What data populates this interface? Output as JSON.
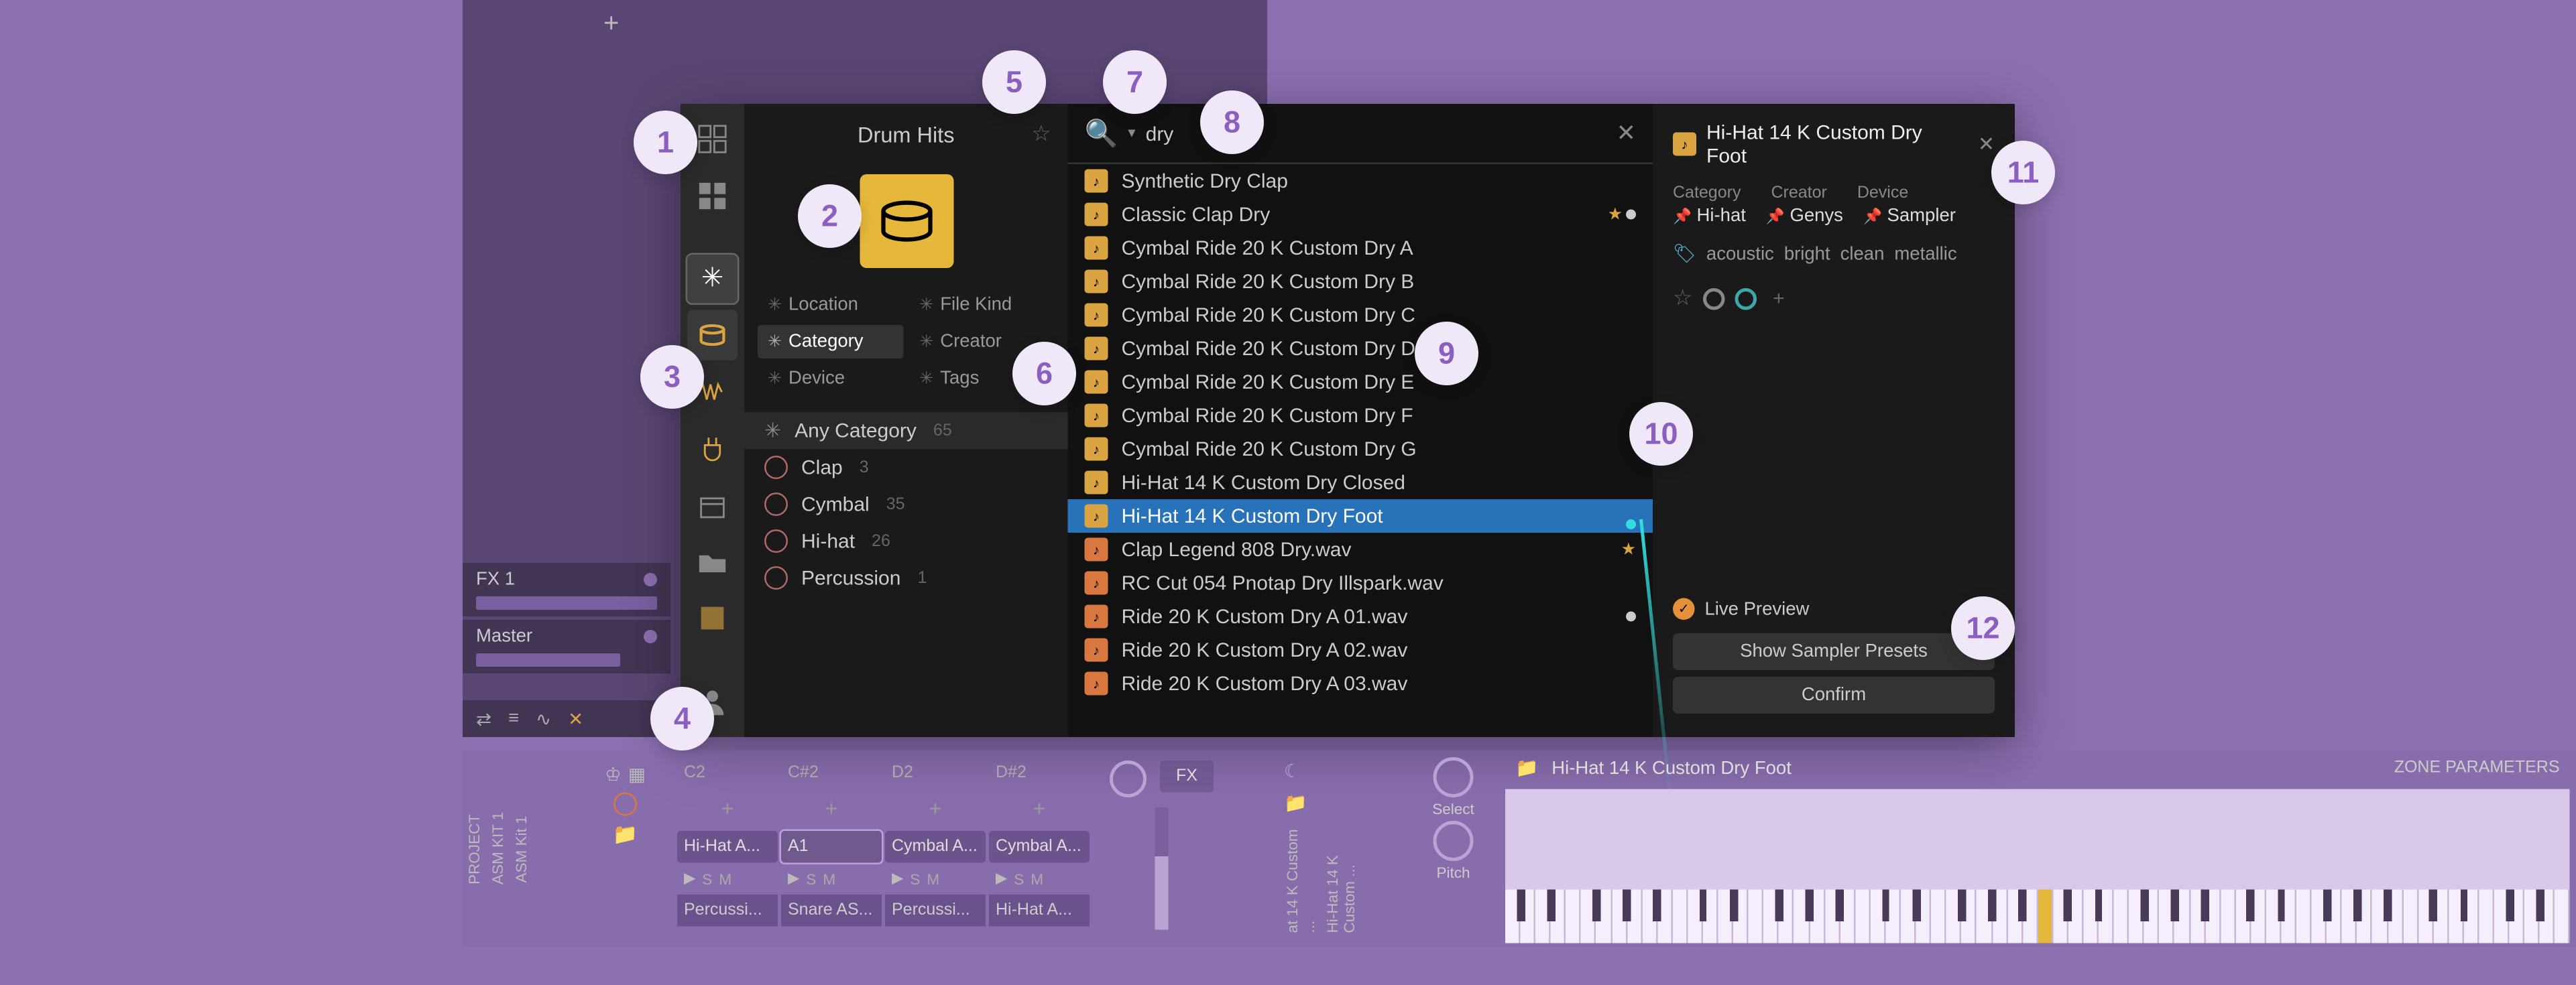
{
  "header": {
    "title": "Drum Hits"
  },
  "search": {
    "query": "dry"
  },
  "filters": {
    "row1": [
      "Location",
      "File Kind"
    ],
    "row2": [
      "Category",
      "Creator"
    ],
    "row3": [
      "Device",
      "Tags"
    ],
    "active": "Category"
  },
  "categories": {
    "any": {
      "label": "Any Category",
      "count": 65
    },
    "items": [
      {
        "label": "Clap",
        "count": 3
      },
      {
        "label": "Cymbal",
        "count": 35
      },
      {
        "label": "Hi-hat",
        "count": 26
      },
      {
        "label": "Percussion",
        "count": 1
      }
    ]
  },
  "results": [
    {
      "label": "Synthetic Dry Clap",
      "icon": "amber"
    },
    {
      "label": "Classic Clap Dry",
      "icon": "amber",
      "star": true,
      "dot": true
    },
    {
      "label": "Cymbal Ride 20 K Custom Dry A",
      "icon": "amber"
    },
    {
      "label": "Cymbal Ride 20 K Custom Dry B",
      "icon": "amber"
    },
    {
      "label": "Cymbal Ride 20 K Custom Dry C",
      "icon": "amber"
    },
    {
      "label": "Cymbal Ride 20 K Custom Dry D",
      "icon": "amber"
    },
    {
      "label": "Cymbal Ride 20 K Custom Dry E",
      "icon": "amber"
    },
    {
      "label": "Cymbal Ride 20 K Custom Dry F",
      "icon": "amber"
    },
    {
      "label": "Cymbal Ride 20 K Custom Dry G",
      "icon": "amber"
    },
    {
      "label": "Hi-Hat 14 K Custom Dry Closed",
      "icon": "amber"
    },
    {
      "label": "Hi-Hat 14 K Custom Dry Foot",
      "icon": "amber",
      "selected": true
    },
    {
      "label": "Clap Legend 808 Dry.wav",
      "icon": "orange",
      "star": true
    },
    {
      "label": "RC Cut 054 Pnotap Dry Illspark.wav",
      "icon": "orange"
    },
    {
      "label": "Ride 20 K Custom Dry A 01.wav",
      "icon": "orange",
      "dot": true
    },
    {
      "label": "Ride 20 K Custom Dry A 02.wav",
      "icon": "orange"
    },
    {
      "label": "Ride 20 K Custom Dry A 03.wav",
      "icon": "orange"
    }
  ],
  "detail": {
    "title": "Hi-Hat 14 K Custom Dry Foot",
    "meta_labels": [
      "Category",
      "Creator",
      "Device"
    ],
    "meta_values": [
      "Hi-hat",
      "Genys",
      "Sampler"
    ],
    "tags": [
      "acoustic",
      "bright",
      "clean",
      "metallic"
    ],
    "live_preview": "Live Preview",
    "btn1": "Show Sampler Presets",
    "btn2": "Confirm"
  },
  "tracks": [
    {
      "name": "FX 1"
    },
    {
      "name": "Master"
    }
  ],
  "pads": {
    "notes": [
      "C2",
      "C#2",
      "D2",
      "D#2"
    ],
    "names": [
      "Hi-Hat A...",
      "A1",
      "Cymbal A...",
      "Cymbal A..."
    ],
    "groups": [
      "Percussi...",
      "Snare AS...",
      "Percussi...",
      "Hi-Hat A..."
    ],
    "fx_label": "FX"
  },
  "vlabels": [
    "PROJECT",
    "ASM KIT 1",
    "ASM Kit 1",
    "at 14 K Custom ...",
    "Hi-Hat 14 K Custom ..."
  ],
  "sampler": {
    "title": "Hi-Hat 14 K Custom Dry Foot",
    "zone": "ZONE PARAMETERS",
    "knob1": "Select",
    "knob2": "Pitch"
  },
  "annotations": [
    "1",
    "2",
    "3",
    "4",
    "5",
    "6",
    "7",
    "8",
    "9",
    "10",
    "11",
    "12"
  ]
}
